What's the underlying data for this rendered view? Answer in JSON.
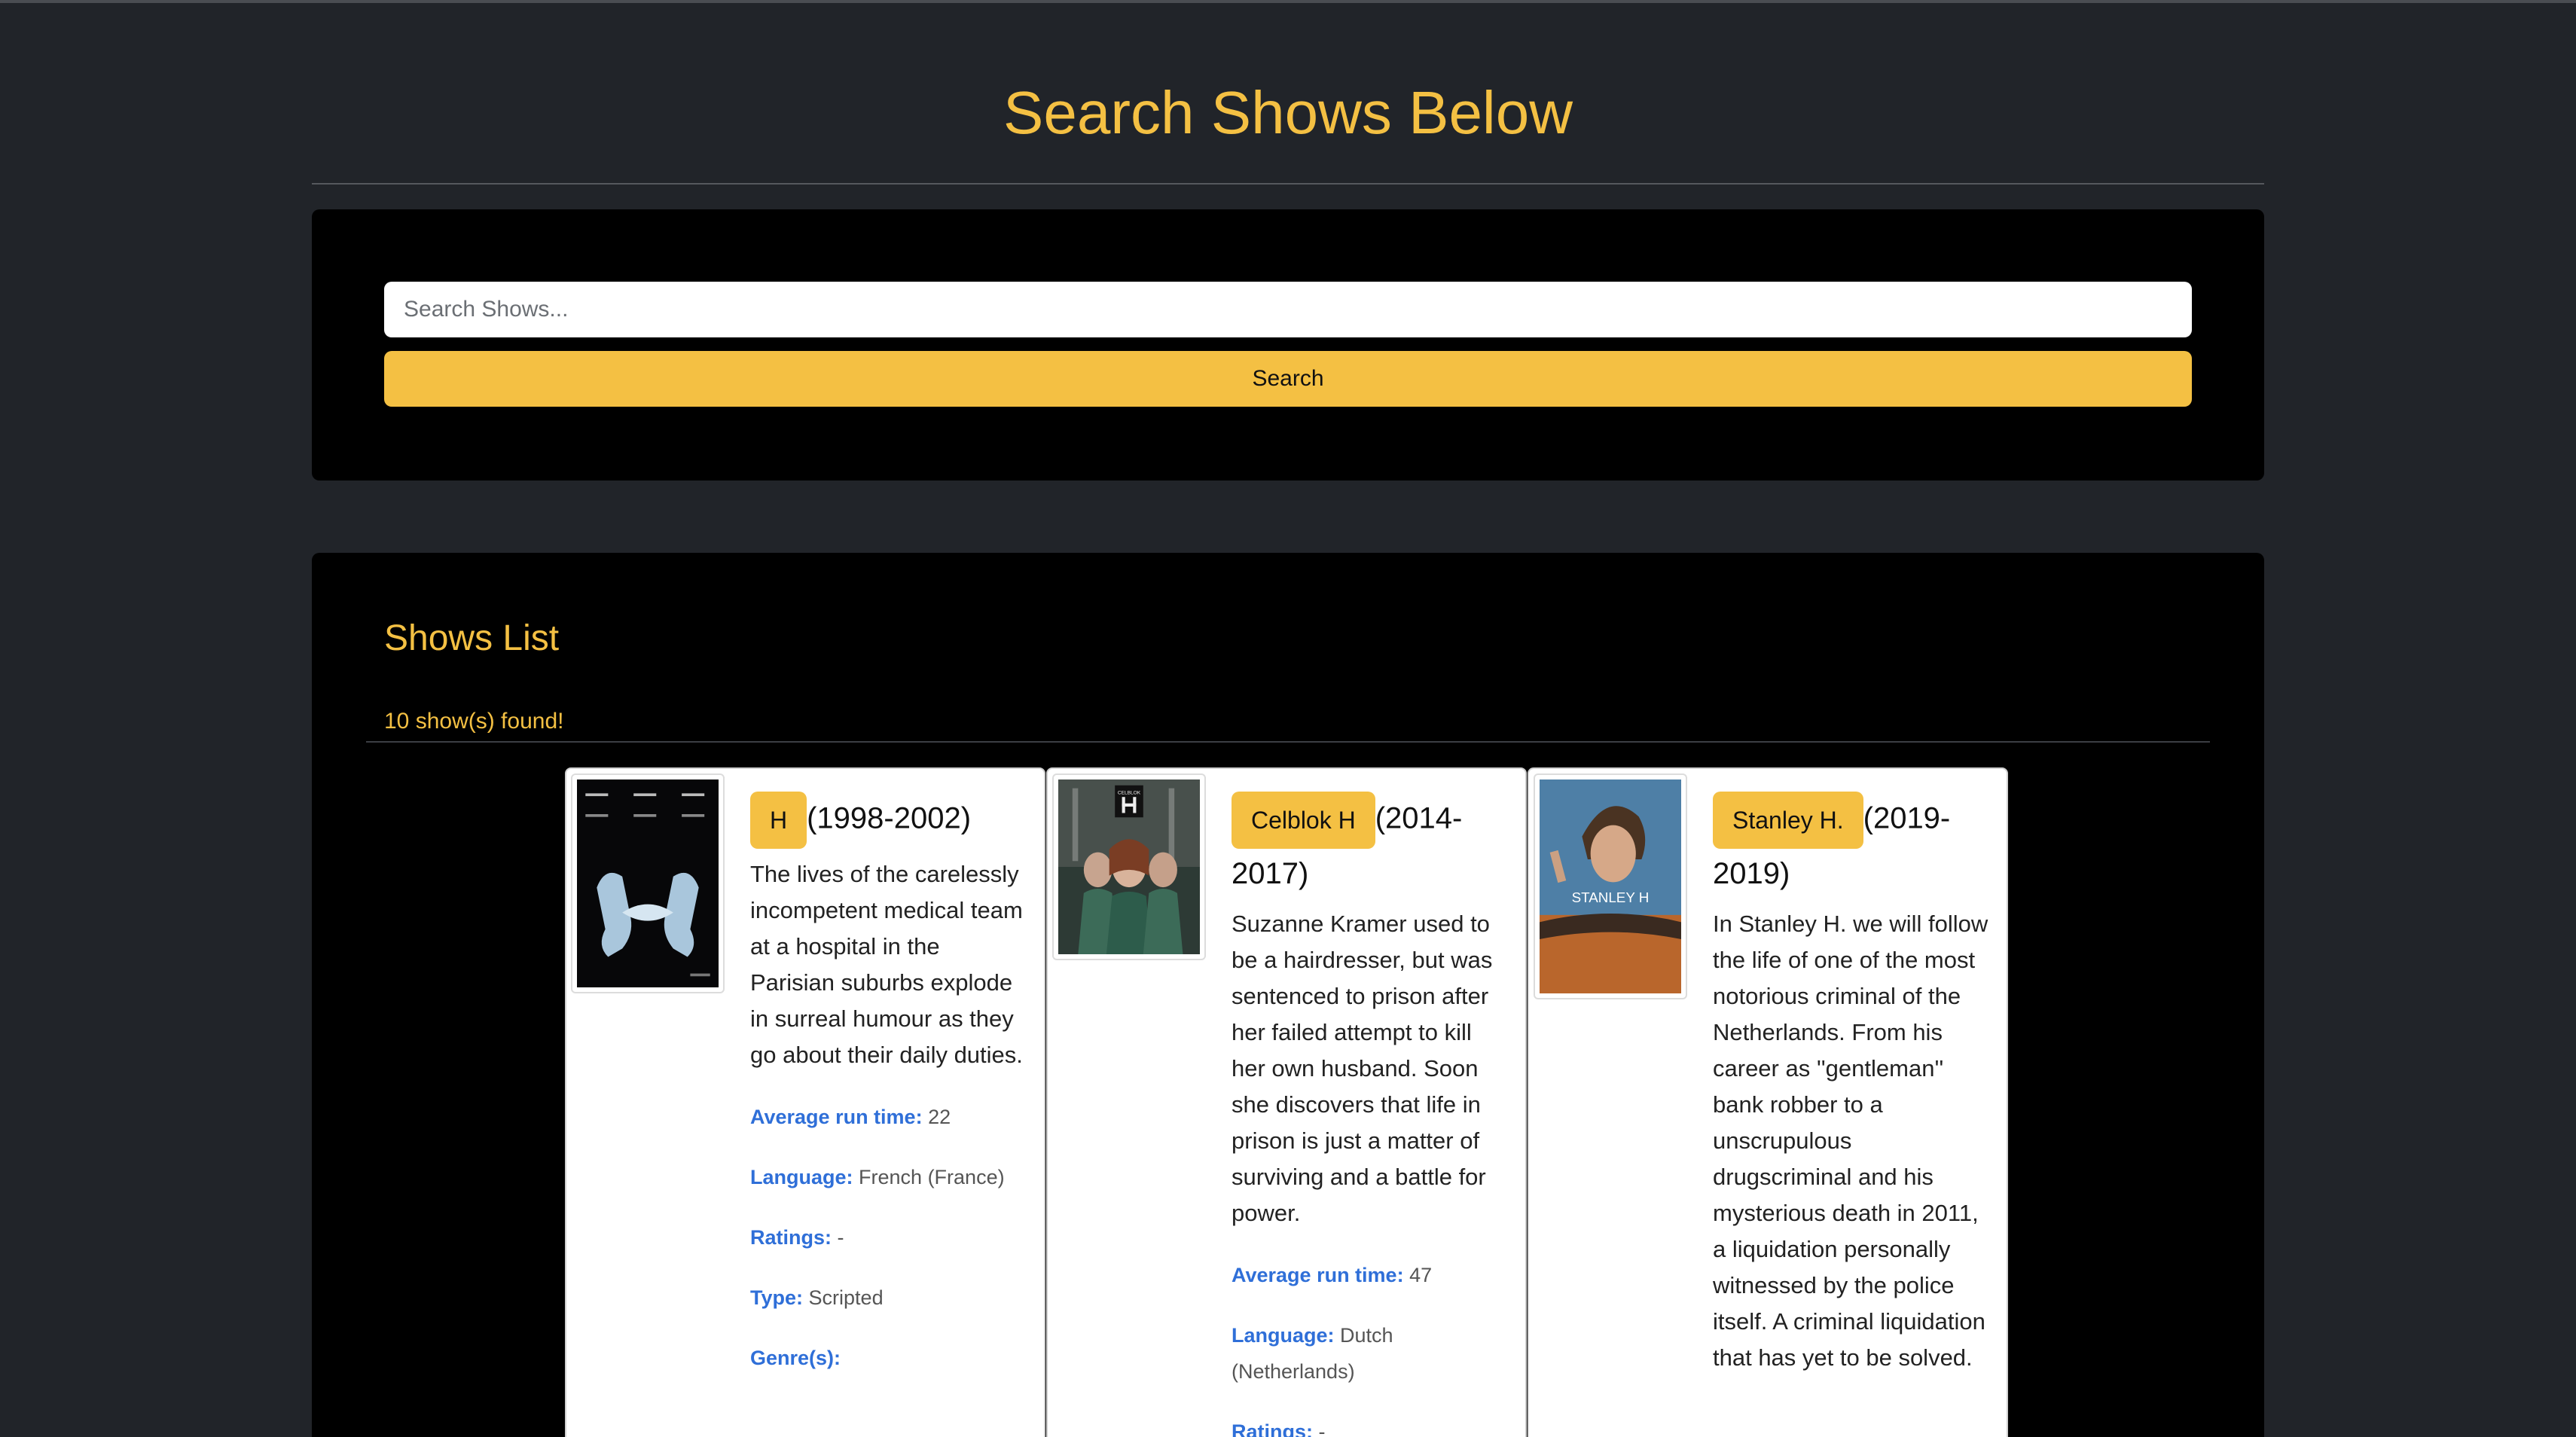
{
  "header": {
    "title": "Search Shows Below"
  },
  "search": {
    "placeholder": "Search Shows...",
    "value": "",
    "button_label": "Search"
  },
  "list": {
    "title": "Shows List",
    "count_text": "10 show(s) found!",
    "labels": {
      "runtime": "Average run time:",
      "language": "Language:",
      "ratings": "Ratings:",
      "type": "Type:",
      "genres": "Genre(s):"
    },
    "shows": [
      {
        "name": "H",
        "years": "(1998-2002)",
        "summary": "The lives of the carelessly incompetent medical team at a hospital in the Parisian suburbs explode in surreal humour as they go about their daily duties.",
        "runtime": "22",
        "language": "French (France)",
        "ratings": "-",
        "type": "Scripted"
      },
      {
        "name": "Celblok H",
        "years": "(2014-2017)",
        "summary": "Suzanne Kramer used to be a hairdresser, but was sentenced to prison after her failed attempt to kill her own husband. Soon she discovers that life in prison is just a matter of surviving and a battle for power.",
        "runtime": "47",
        "language": "Dutch (Netherlands)",
        "ratings": "-",
        "poster_text": "CELBLOK"
      },
      {
        "name": "Stanley H.",
        "years": "(2019-2019)",
        "summary": "In Stanley H. we will follow the life of one of the most notorious criminal of the Netherlands. From his career as ''gentleman'' bank robber to a unscrupulous drugscriminal and his mysterious death in 2011, a liquidation personally witnessed by the police itself. A criminal liquidation that has yet to be solved.",
        "poster_text": "STANLEY H"
      }
    ]
  },
  "colors": {
    "accent": "#f4c043",
    "background": "#212429",
    "panel": "#000000",
    "label_blue": "#2f6fd8"
  }
}
